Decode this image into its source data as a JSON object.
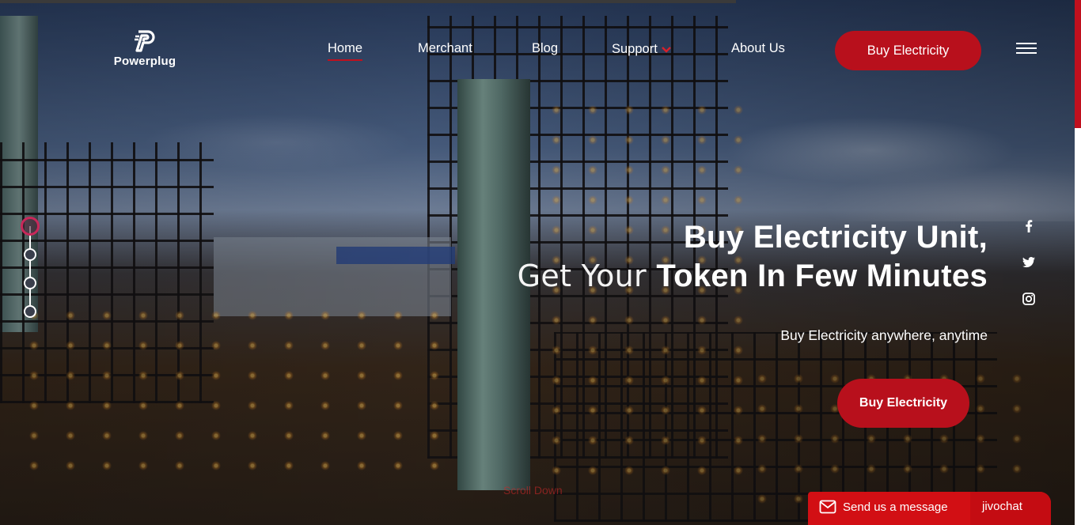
{
  "brand": {
    "name": "Powerplug",
    "accent": "#b8101c"
  },
  "nav": {
    "items": [
      {
        "label": "Home",
        "active": true
      },
      {
        "label": "Merchant",
        "active": false
      },
      {
        "label": "Blog",
        "active": false
      },
      {
        "label": "Support",
        "active": false,
        "has_dropdown": true
      },
      {
        "label": "About Us",
        "active": false
      }
    ],
    "cta_label": "Buy Electricity",
    "menu_icon": "hamburger-icon"
  },
  "hero": {
    "title_line1": "Buy Electricity Unit,",
    "title_line2_light": "Get Your ",
    "title_line2_bold": "Token In Few Minutes",
    "subtitle": "Buy Electricity anywhere, anytime",
    "cta_label": "Buy Electricity",
    "slides": {
      "count": 4,
      "active_index": 0
    },
    "scroll_hint": "Scroll Down"
  },
  "social": [
    {
      "icon": "facebook-icon"
    },
    {
      "icon": "twitter-icon"
    },
    {
      "icon": "instagram-icon"
    }
  ],
  "chat_widget": {
    "message_label": "Send us a message",
    "brand_label": "jivochat",
    "color": "#d20f14"
  }
}
